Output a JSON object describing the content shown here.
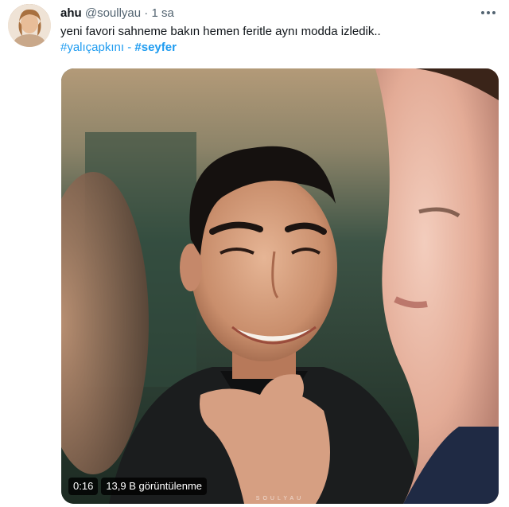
{
  "tweet": {
    "display_name": "ahu",
    "handle": "@soullyau",
    "separator": "·",
    "time": "1 sa",
    "text": "yeni favori sahneme bakın hemen feritle aynı modda izledik..",
    "hashtag_1": "#yalıçapkını",
    "hashtag_separator": "-",
    "hashtag_2": "#seyfer"
  },
  "media": {
    "duration": "0:16",
    "views": "13,9 B görüntülenme",
    "watermark": "SOULYAU"
  },
  "icons": {
    "more": "more-horizontal-icon"
  },
  "colors": {
    "link": "#1d9bf0",
    "secondary_text": "#536471",
    "primary_text": "#0f1419"
  }
}
